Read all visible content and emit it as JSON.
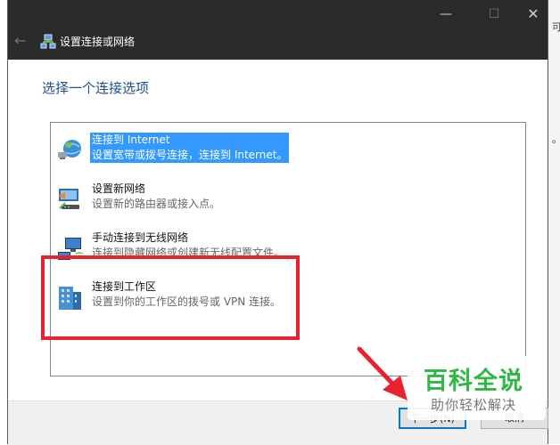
{
  "background": {
    "text_top": "可",
    "text_mid": "。"
  },
  "window": {
    "title": "设置连接或网络",
    "controls": {
      "minimize": "—",
      "maximize": "☐",
      "close": "✕"
    },
    "back": "←"
  },
  "heading": "选择一个连接选项",
  "options": [
    {
      "title": "连接到 Internet",
      "desc": "设置宽带或拨号连接，连接到 Internet。",
      "icon": "globe-network-icon",
      "selected": true
    },
    {
      "title": "设置新网络",
      "desc": "设置新的路由器或接入点。",
      "icon": "router-setup-icon",
      "selected": false
    },
    {
      "title": "手动连接到无线网络",
      "desc": "连接到隐藏网络或创建新无线配置文件。",
      "icon": "wireless-computer-icon",
      "selected": false
    },
    {
      "title": "连接到工作区",
      "desc": "设置到你的工作区的拨号或 VPN 连接。",
      "icon": "workplace-building-icon",
      "selected": false
    }
  ],
  "buttons": {
    "next": "下一步(N)",
    "cancel": "取消"
  },
  "watermark": {
    "main": "百科全说",
    "sub": "助你轻松解决"
  },
  "colors": {
    "selection": "#3399ff",
    "highlight_box": "#e8232f",
    "arrow": "#e8232f",
    "heading": "#1e4e8c",
    "watermark": "#2fb843"
  }
}
